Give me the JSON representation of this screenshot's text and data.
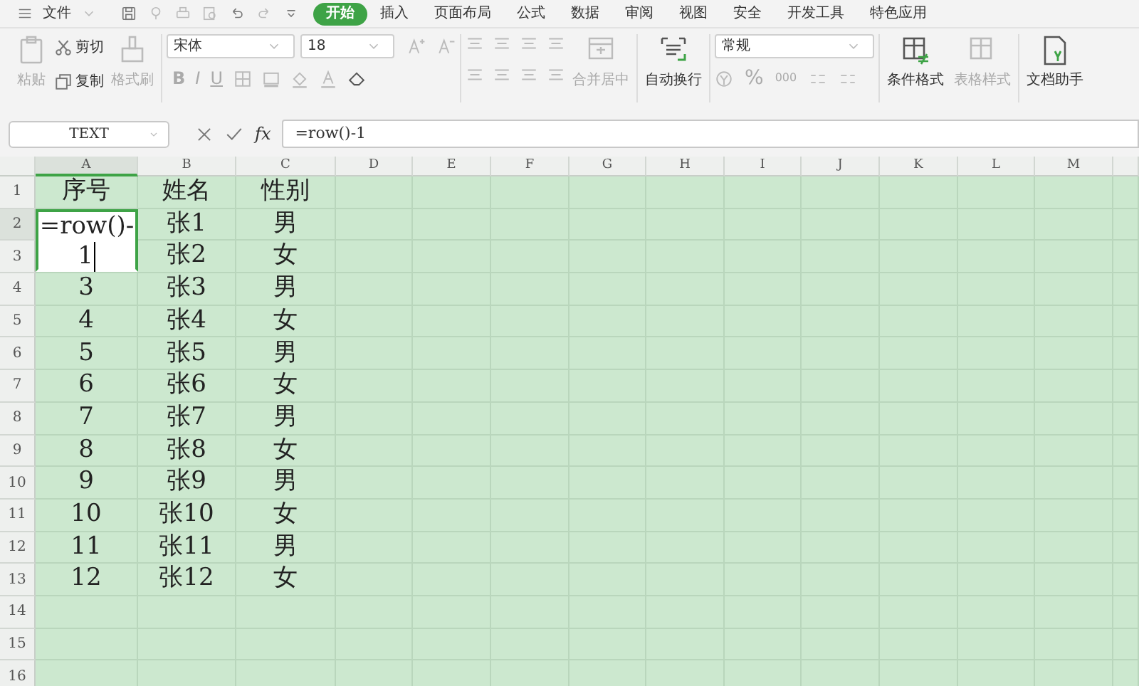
{
  "menu": {
    "label": "文件"
  },
  "tabs": [
    {
      "label": "开始",
      "selected": true
    },
    {
      "label": "插入",
      "selected": false
    },
    {
      "label": "页面布局",
      "selected": false
    },
    {
      "label": "公式",
      "selected": false
    },
    {
      "label": "数据",
      "selected": false
    },
    {
      "label": "审阅",
      "selected": false
    },
    {
      "label": "视图",
      "selected": false
    },
    {
      "label": "安全",
      "selected": false
    },
    {
      "label": "开发工具",
      "selected": false
    },
    {
      "label": "特色应用",
      "selected": false
    }
  ],
  "ribbon": {
    "paste": {
      "label": "粘贴",
      "disabled": true
    },
    "cut": {
      "label": "剪切",
      "disabled": false
    },
    "copy": {
      "label": "复制",
      "disabled": false
    },
    "format_painter": {
      "label": "格式刷",
      "disabled": true
    },
    "font_name": "宋体",
    "font_size": "18",
    "style_buttons": [
      "B",
      "I",
      "U"
    ],
    "merge": {
      "label": "合并居中",
      "disabled": true
    },
    "wrap": {
      "label": "自动换行",
      "disabled": false
    },
    "number_format": "常规",
    "number_buttons": [
      "%",
      "000"
    ],
    "conditional": {
      "label": "条件格式",
      "disabled": false
    },
    "table_style": {
      "label": "表格样式",
      "disabled": true
    },
    "assistant": {
      "label": "文档助手",
      "disabled": false
    }
  },
  "formula_bar": {
    "name_box": "TEXT",
    "fx_label": "fx",
    "formula": "=row()-1"
  },
  "sheet": {
    "columns": [
      {
        "label": "A",
        "selected": true
      },
      {
        "label": "B",
        "selected": false
      },
      {
        "label": "C",
        "selected": false
      },
      {
        "label": "D",
        "selected": false
      },
      {
        "label": "E",
        "selected": false
      },
      {
        "label": "F",
        "selected": false
      },
      {
        "label": "G",
        "selected": false
      },
      {
        "label": "H",
        "selected": false
      },
      {
        "label": "I",
        "selected": false
      },
      {
        "label": "J",
        "selected": false
      },
      {
        "label": "K",
        "selected": false
      },
      {
        "label": "L",
        "selected": false
      },
      {
        "label": "M",
        "selected": false
      }
    ],
    "rows": [
      {
        "number": "1",
        "selected": false,
        "cells": [
          "序号",
          "姓名",
          "性别"
        ]
      },
      {
        "number": "2",
        "selected": true,
        "cells": [
          null,
          "张1",
          "男"
        ]
      },
      {
        "number": "3",
        "selected": false,
        "cells": [
          null,
          "张2",
          "女"
        ]
      },
      {
        "number": "4",
        "selected": false,
        "cells": [
          "3",
          "张3",
          "男"
        ]
      },
      {
        "number": "5",
        "selected": false,
        "cells": [
          "4",
          "张4",
          "女"
        ]
      },
      {
        "number": "6",
        "selected": false,
        "cells": [
          "5",
          "张5",
          "男"
        ]
      },
      {
        "number": "7",
        "selected": false,
        "cells": [
          "6",
          "张6",
          "女"
        ]
      },
      {
        "number": "8",
        "selected": false,
        "cells": [
          "7",
          "张7",
          "男"
        ]
      },
      {
        "number": "9",
        "selected": false,
        "cells": [
          "8",
          "张8",
          "女"
        ]
      },
      {
        "number": "10",
        "selected": false,
        "cells": [
          "9",
          "张9",
          "男"
        ]
      },
      {
        "number": "11",
        "selected": false,
        "cells": [
          "10",
          "张10",
          "女"
        ]
      },
      {
        "number": "12",
        "selected": false,
        "cells": [
          "11",
          "张11",
          "男"
        ]
      },
      {
        "number": "13",
        "selected": false,
        "cells": [
          "12",
          "张12",
          "女"
        ]
      },
      {
        "number": "14",
        "selected": false,
        "cells": []
      },
      {
        "number": "15",
        "selected": false,
        "cells": []
      },
      {
        "number": "16",
        "selected": false,
        "cells": []
      }
    ],
    "editor": {
      "lines": [
        "=row()-",
        "1"
      ]
    }
  }
}
